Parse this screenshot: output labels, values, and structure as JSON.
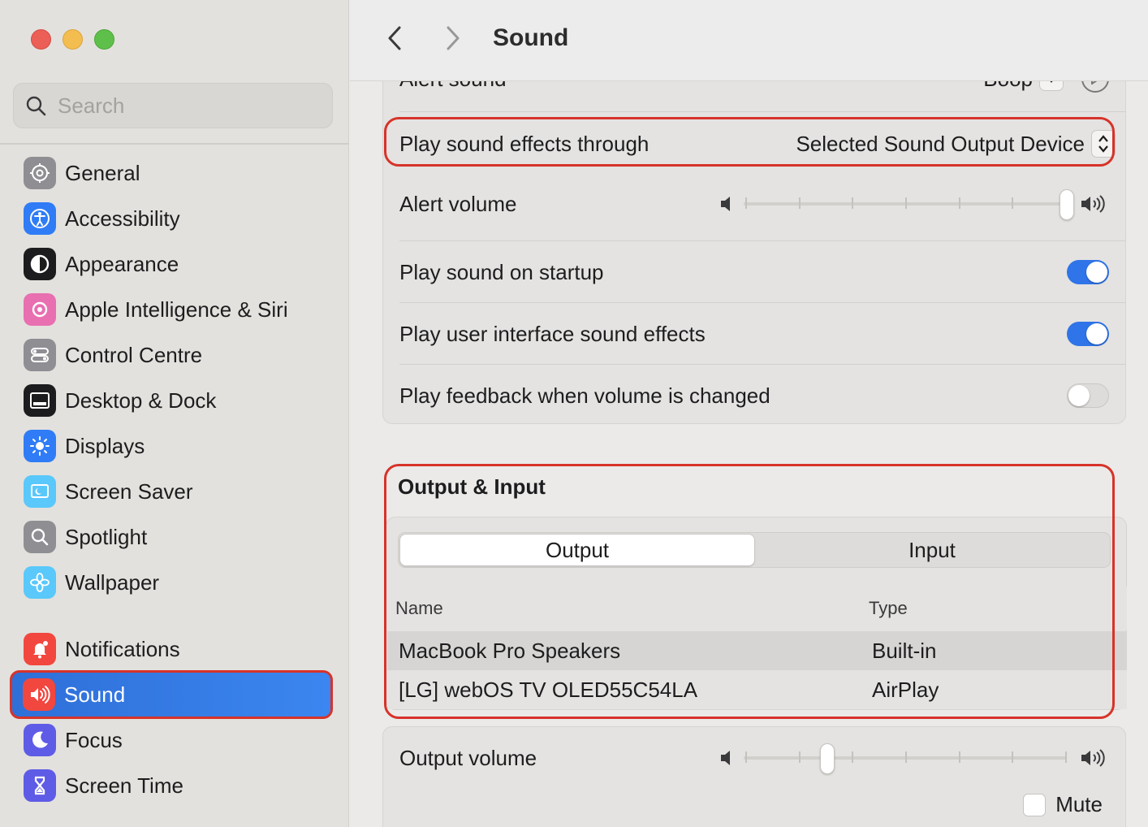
{
  "window": {
    "title": "Sound",
    "back_label": "Back",
    "forward_label": "Forward"
  },
  "search": {
    "placeholder": "Search",
    "value": ""
  },
  "sidebar": {
    "items": [
      {
        "label": "General",
        "icon": "gear-icon",
        "color": "#8e8e93"
      },
      {
        "label": "Accessibility",
        "icon": "accessibility-icon",
        "color": "#2f7cf6"
      },
      {
        "label": "Appearance",
        "icon": "appearance-icon",
        "color": "#1c1c1e"
      },
      {
        "label": "Apple Intelligence & Siri",
        "icon": "siri-icon",
        "color": "#e86fb0"
      },
      {
        "label": "Control Centre",
        "icon": "control-centre-icon",
        "color": "#8e8e93"
      },
      {
        "label": "Desktop & Dock",
        "icon": "dock-icon",
        "color": "#1c1c1e"
      },
      {
        "label": "Displays",
        "icon": "displays-icon",
        "color": "#2f7cf6"
      },
      {
        "label": "Screen Saver",
        "icon": "screen-saver-icon",
        "color": "#5ac8fa"
      },
      {
        "label": "Spotlight",
        "icon": "spotlight-icon",
        "color": "#8e8e93"
      },
      {
        "label": "Wallpaper",
        "icon": "wallpaper-icon",
        "color": "#5ac8fa"
      },
      {
        "label": "Notifications",
        "icon": "notifications-icon",
        "color": "#f2473f"
      },
      {
        "label": "Sound",
        "icon": "sound-icon",
        "color": "#f2473f",
        "selected": true
      },
      {
        "label": "Focus",
        "icon": "focus-icon",
        "color": "#5e5ce6"
      },
      {
        "label": "Screen Time",
        "icon": "screen-time-icon",
        "color": "#5e5ce6"
      }
    ]
  },
  "effects": {
    "alert_sound_label": "Alert sound",
    "alert_sound_value": "Boop",
    "play_through_label": "Play sound effects through",
    "play_through_value": "Selected Sound Output Device",
    "alert_volume_label": "Alert volume",
    "alert_volume_fraction": 1.0,
    "startup_label": "Play sound on startup",
    "startup_on": true,
    "ui_effects_label": "Play user interface sound effects",
    "ui_effects_on": true,
    "feedback_label": "Play feedback when volume is changed",
    "feedback_on": false
  },
  "output_input": {
    "section_title": "Output & Input",
    "tabs": [
      "Output",
      "Input"
    ],
    "selected_tab": "Output",
    "columns": [
      "Name",
      "Type"
    ],
    "devices": [
      {
        "name": "MacBook Pro Speakers",
        "type": "Built-in",
        "selected": true
      },
      {
        "name": "[LG] webOS TV OLED55C54LA",
        "type": "AirPlay",
        "selected": false
      }
    ]
  },
  "output": {
    "volume_label": "Output volume",
    "volume_fraction": 0.26,
    "mute_label": "Mute",
    "muted": false
  },
  "colors": {
    "accent": "#2f74e8",
    "highlight": "#d7332a"
  }
}
